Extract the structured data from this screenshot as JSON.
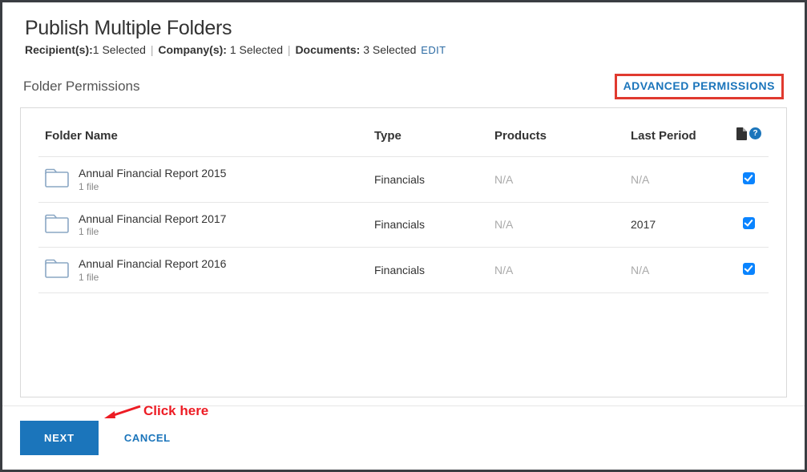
{
  "header": {
    "title": "Publish Multiple Folders",
    "recipientsLabel": "Recipient(s):",
    "recipientsValue": "1 Selected",
    "companyLabel": "Company(s):",
    "companyValue": "1 Selected",
    "documentsLabel": "Documents:",
    "documentsValue": "3 Selected",
    "editLabel": "EDIT"
  },
  "section": {
    "title": "Folder Permissions",
    "advancedPermissions": "ADVANCED PERMISSIONS"
  },
  "table": {
    "headers": {
      "folderName": "Folder Name",
      "type": "Type",
      "products": "Products",
      "lastPeriod": "Last Period"
    },
    "rows": [
      {
        "name": "Annual Financial Report 2015",
        "sub": "1 file",
        "type": "Financials",
        "products": "N/A",
        "lastPeriod": "N/A",
        "lastPeriodMuted": true,
        "checked": true
      },
      {
        "name": "Annual Financial Report 2017",
        "sub": "1 file",
        "type": "Financials",
        "products": "N/A",
        "lastPeriod": "2017",
        "lastPeriodMuted": false,
        "checked": true
      },
      {
        "name": "Annual Financial Report 2016",
        "sub": "1 file",
        "type": "Financials",
        "products": "N/A",
        "lastPeriod": "N/A",
        "lastPeriodMuted": true,
        "checked": true
      }
    ]
  },
  "footer": {
    "next": "NEXT",
    "cancel": "CANCEL"
  },
  "annotation": {
    "text": "Click here"
  }
}
